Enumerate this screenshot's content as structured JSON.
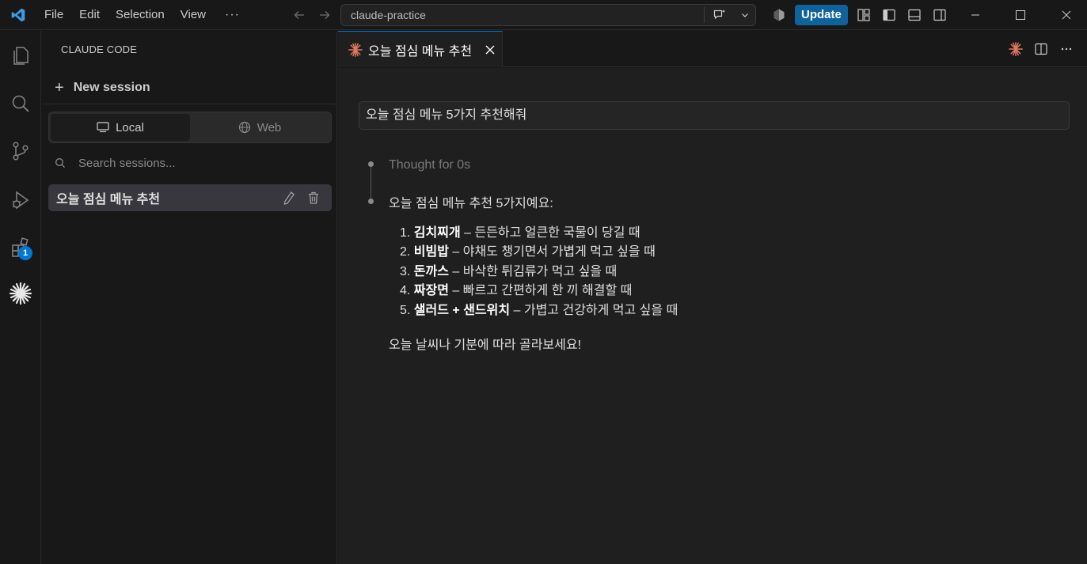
{
  "titlebar": {
    "menu": [
      "File",
      "Edit",
      "Selection",
      "View",
      "···"
    ],
    "search_text": "claude-practice",
    "update_label": "Update"
  },
  "activitybar": {
    "icons": [
      "explorer-icon",
      "search-icon",
      "source-control-icon",
      "run-debug-icon",
      "extensions-icon",
      "claude-icon"
    ],
    "extensions_badge": "1"
  },
  "sidebar": {
    "title": "CLAUDE CODE",
    "new_session_label": "New session",
    "tabs": [
      {
        "label": "Local",
        "active": true
      },
      {
        "label": "Web",
        "active": false
      }
    ],
    "search_placeholder": "Search sessions...",
    "sessions": [
      {
        "label": "오늘 점심 메뉴 추천",
        "selected": true
      }
    ]
  },
  "editor": {
    "tab_label": "오늘 점심 메뉴 추천",
    "user_prompt": "오늘 점심 메뉴 5가지 추천해줘",
    "thought": "Thought for 0s",
    "response_intro": "오늘 점심 메뉴 추천 5가지예요:",
    "items": [
      {
        "num": "1.",
        "name": "김치찌개",
        "desc": " – 든든하고 얼큰한 국물이 당길 때"
      },
      {
        "num": "2.",
        "name": "비빔밥",
        "desc": " – 야채도 챙기면서 가볍게 먹고 싶을 때"
      },
      {
        "num": "3.",
        "name": "돈까스",
        "desc": " – 바삭한 튀김류가 먹고 싶을 때"
      },
      {
        "num": "4.",
        "name": "짜장면",
        "desc": " – 빠르고 간편하게 한 끼 해결할 때"
      },
      {
        "num": "5.",
        "name": "샐러드 + 샌드위치",
        "desc": " – 가볍고 건강하게 먹고 싶을 때"
      }
    ],
    "response_outro": "오늘 날씨나 기분에 따라 골라보세요!"
  },
  "colors": {
    "accent": "#0078d4",
    "claude": "#e07a5f",
    "update_button": "#0e639c"
  }
}
